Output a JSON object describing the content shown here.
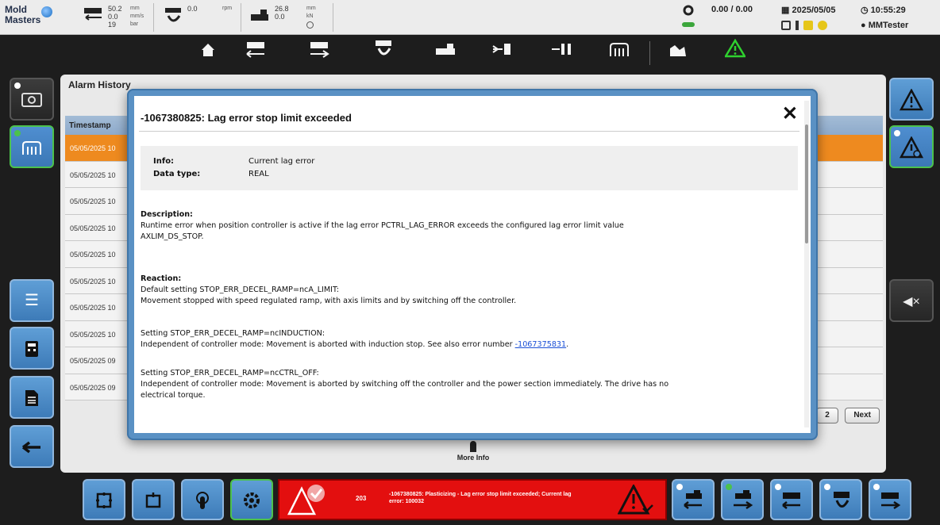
{
  "header": {
    "logo_text_1": "Mold",
    "logo_text_2": "Masters",
    "gauges": [
      {
        "icon": "screw-speed-icon",
        "v1": "50.2",
        "v2": "0.0",
        "v3": "19",
        "u1": "mm",
        "u2": "mm/s",
        "u3": "bar"
      },
      {
        "icon": "rotation-icon",
        "v1": "0.0",
        "u1": "rpm"
      },
      {
        "icon": "clamp-force-icon",
        "v1": "26.8",
        "v2": "0.0",
        "u1": "mm",
        "u2": "kN"
      }
    ],
    "counter": "0.00 / 0.00",
    "date": "2025/05/05",
    "time": "10:55:29",
    "user": "MMTester"
  },
  "nav": {
    "items": [
      "home-icon",
      "injection-icon",
      "injection-unit-icon",
      "plasticizing-icon",
      "clamp-icon",
      "ejector-icon",
      "core-pull-icon",
      "heating-icon",
      "monitoring-icon",
      "warning-icon"
    ]
  },
  "page": {
    "title": "Alarm History",
    "column_timestamp": "Timestamp",
    "rows": [
      "05/05/2025 10",
      "05/05/2025 10",
      "05/05/2025 10",
      "05/05/2025 10",
      "05/05/2025 10",
      "05/05/2025 10",
      "05/05/2025 10",
      "05/05/2025 10",
      "05/05/2025 09",
      "05/05/2025 09"
    ],
    "pager_page": "2",
    "pager_next": "Next",
    "more_info": "More Info"
  },
  "modal": {
    "title": "-1067380825: Lag error stop limit exceeded",
    "close": "✕",
    "info_label": "Info:",
    "info_value": "Current lag error",
    "type_label": "Data type:",
    "type_value": "REAL",
    "description_heading": "Description:",
    "description_line1": "Runtime error when position controller is active if the lag error PCTRL_LAG_ERROR exceeds the configured lag error limit value",
    "description_line2": "AXLIM_DS_STOP.",
    "reaction_heading": "Reaction:",
    "reaction_l1": "Default setting STOP_ERR_DECEL_RAMP=ncA_LIMIT:",
    "reaction_l2": "Movement stopped with speed regulated ramp, with axis limits and by switching off the controller.",
    "reaction_l3": "Setting STOP_ERR_DECEL_RAMP=ncINDUCTION:",
    "reaction_l4a": "Independent of controller mode: Movement is aborted with induction stop. See also error number ",
    "reaction_link": "-1067375831",
    "reaction_l4b": ".",
    "reaction_l5": "Setting STOP_ERR_DECEL_RAMP=ncCTRL_OFF:",
    "reaction_l6": "Independent of controller mode: Movement is aborted by switching off the controller and the power section immediately. The drive has no",
    "reaction_l7": "electrical torque."
  },
  "alarm": {
    "count": "203",
    "message": "-1067380825: Plasticizing - Lag error stop limit exceeded; Current lag error: 100032"
  },
  "colors": {
    "accent_blue": "#4a88c6",
    "selected_row": "#ee8a1f",
    "alarm_red": "#e30f0f",
    "active_green": "#4cc24c"
  }
}
